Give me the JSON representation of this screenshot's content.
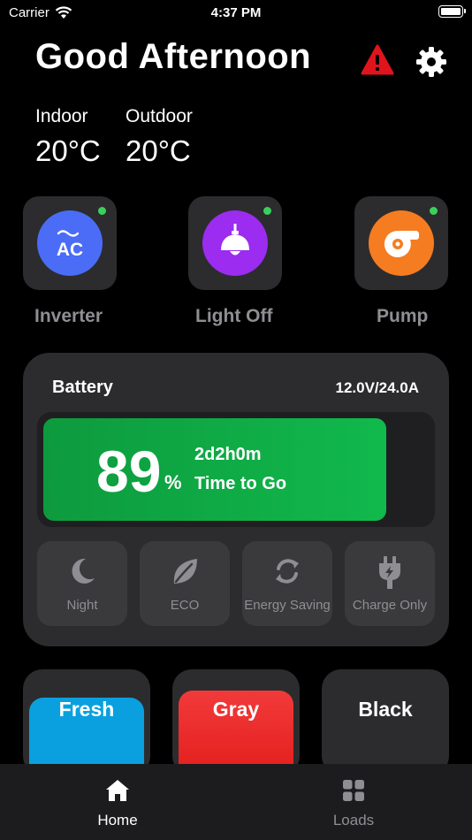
{
  "status_bar": {
    "carrier": "Carrier",
    "time": "4:37 PM"
  },
  "header": {
    "greeting": "Good Afternoon"
  },
  "temperatures": {
    "indoor": {
      "label": "Indoor",
      "value": "20°C"
    },
    "outdoor": {
      "label": "Outdoor",
      "value": "20°C"
    }
  },
  "devices": [
    {
      "label": "Inverter",
      "icon": "ac-icon",
      "color": "#4a6cf7",
      "status_color": "#3ad15a",
      "icon_text": "AC"
    },
    {
      "label": "Light Off",
      "icon": "lamp-icon",
      "color": "#9b2cf0",
      "status_color": "#3ad15a"
    },
    {
      "label": "Pump",
      "icon": "pump-icon",
      "color": "#f57c20",
      "status_color": "#3ad15a"
    }
  ],
  "battery": {
    "title": "Battery",
    "spec": "12.0V/24.0A",
    "percent": "89",
    "percent_sign": "%",
    "level": 0.89,
    "time_left": "2d2h0m",
    "time_label": "Time to Go",
    "modes": [
      {
        "label": "Night",
        "icon": "moon-icon"
      },
      {
        "label": "ECO",
        "icon": "leaf-icon"
      },
      {
        "label": "Energy Saving",
        "icon": "recycle-icon"
      },
      {
        "label": "Charge Only",
        "icon": "plug-icon"
      }
    ]
  },
  "tanks": [
    {
      "label": "Fresh",
      "color": "#0aa0e0"
    },
    {
      "label": "Gray",
      "color": "#ec2a2a"
    },
    {
      "label": "Black",
      "color": "#2c2c2e"
    }
  ],
  "tabs": [
    {
      "label": "Home",
      "icon": "home-icon",
      "active": true
    },
    {
      "label": "Loads",
      "icon": "grid-icon",
      "active": false
    }
  ],
  "colors": {
    "alert": "#e0141c",
    "accent_green": "#11b94c"
  }
}
